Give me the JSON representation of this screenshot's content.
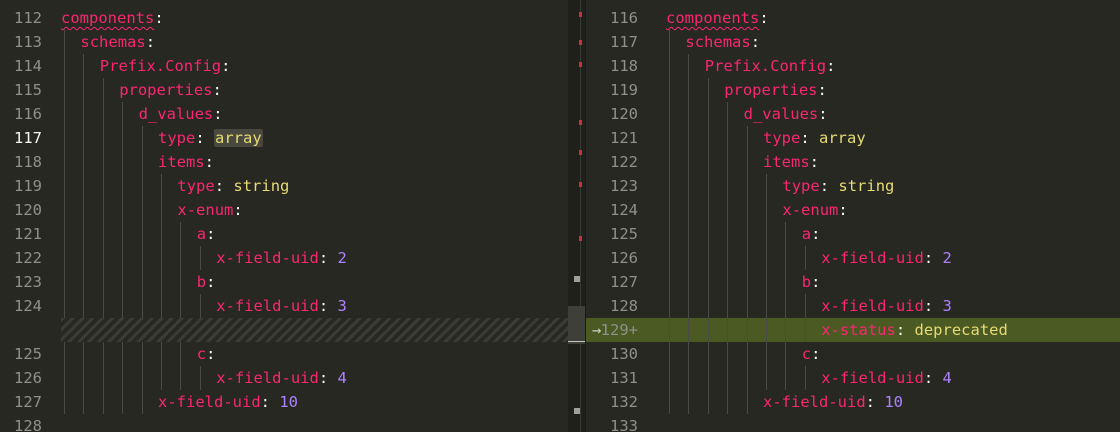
{
  "left": {
    "rows": [
      {
        "ln": "112",
        "active": false,
        "indent": 0,
        "tokens": [
          {
            "t": "components",
            "c": "k",
            "sq": true
          },
          {
            "t": ":",
            "c": "p"
          }
        ]
      },
      {
        "ln": "113",
        "active": false,
        "indent": 1,
        "tokens": [
          {
            "t": "schemas",
            "c": "k"
          },
          {
            "t": ":",
            "c": "p"
          }
        ]
      },
      {
        "ln": "114",
        "active": false,
        "indent": 2,
        "tokens": [
          {
            "t": "Prefix.Config",
            "c": "k"
          },
          {
            "t": ":",
            "c": "p"
          }
        ]
      },
      {
        "ln": "115",
        "active": false,
        "indent": 3,
        "tokens": [
          {
            "t": "properties",
            "c": "k"
          },
          {
            "t": ":",
            "c": "p"
          }
        ]
      },
      {
        "ln": "116",
        "active": false,
        "indent": 4,
        "tokens": [
          {
            "t": "d_values",
            "c": "k"
          },
          {
            "t": ":",
            "c": "p"
          }
        ]
      },
      {
        "ln": "117",
        "active": true,
        "indent": 5,
        "tokens": [
          {
            "t": "type",
            "c": "k"
          },
          {
            "t": ": ",
            "c": "p"
          },
          {
            "t": "array",
            "c": "s",
            "hl": true
          }
        ]
      },
      {
        "ln": "118",
        "active": false,
        "indent": 5,
        "tokens": [
          {
            "t": "items",
            "c": "k"
          },
          {
            "t": ":",
            "c": "p"
          }
        ]
      },
      {
        "ln": "119",
        "active": false,
        "indent": 6,
        "tokens": [
          {
            "t": "type",
            "c": "k"
          },
          {
            "t": ": ",
            "c": "p"
          },
          {
            "t": "string",
            "c": "s"
          }
        ]
      },
      {
        "ln": "120",
        "active": false,
        "indent": 6,
        "tokens": [
          {
            "t": "x-enum",
            "c": "k"
          },
          {
            "t": ":",
            "c": "p"
          }
        ]
      },
      {
        "ln": "121",
        "active": false,
        "indent": 7,
        "tokens": [
          {
            "t": "a",
            "c": "k"
          },
          {
            "t": ":",
            "c": "p"
          }
        ]
      },
      {
        "ln": "122",
        "active": false,
        "indent": 8,
        "tokens": [
          {
            "t": "x-field-uid",
            "c": "k"
          },
          {
            "t": ": ",
            "c": "p"
          },
          {
            "t": "2",
            "c": "n"
          }
        ]
      },
      {
        "ln": "123",
        "active": false,
        "indent": 7,
        "tokens": [
          {
            "t": "b",
            "c": "k"
          },
          {
            "t": ":",
            "c": "p"
          }
        ]
      },
      {
        "ln": "124",
        "active": false,
        "indent": 8,
        "tokens": [
          {
            "t": "x-field-uid",
            "c": "k"
          },
          {
            "t": ": ",
            "c": "p"
          },
          {
            "t": "3",
            "c": "n"
          }
        ]
      },
      {
        "ln": "",
        "active": false,
        "indent": 0,
        "placeholder": true,
        "tokens": []
      },
      {
        "ln": "125",
        "active": false,
        "indent": 7,
        "tokens": [
          {
            "t": "c",
            "c": "k"
          },
          {
            "t": ":",
            "c": "p"
          }
        ]
      },
      {
        "ln": "126",
        "active": false,
        "indent": 8,
        "tokens": [
          {
            "t": "x-field-uid",
            "c": "k"
          },
          {
            "t": ": ",
            "c": "p"
          },
          {
            "t": "4",
            "c": "n"
          }
        ]
      },
      {
        "ln": "127",
        "active": false,
        "indent": 5,
        "tokens": [
          {
            "t": "x-field-uid",
            "c": "k"
          },
          {
            "t": ": ",
            "c": "p"
          },
          {
            "t": "10",
            "c": "n"
          }
        ]
      },
      {
        "ln": "128",
        "active": false,
        "indent": 0,
        "tokens": []
      }
    ]
  },
  "right": {
    "rows": [
      {
        "ln": "116",
        "active": false,
        "indent": 0,
        "tokens": [
          {
            "t": "components",
            "c": "k",
            "sq": true
          },
          {
            "t": ":",
            "c": "p"
          }
        ]
      },
      {
        "ln": "117",
        "active": false,
        "indent": 1,
        "tokens": [
          {
            "t": "schemas",
            "c": "k"
          },
          {
            "t": ":",
            "c": "p"
          }
        ]
      },
      {
        "ln": "118",
        "active": false,
        "indent": 2,
        "tokens": [
          {
            "t": "Prefix.Config",
            "c": "k"
          },
          {
            "t": ":",
            "c": "p"
          }
        ]
      },
      {
        "ln": "119",
        "active": false,
        "indent": 3,
        "tokens": [
          {
            "t": "properties",
            "c": "k"
          },
          {
            "t": ":",
            "c": "p"
          }
        ]
      },
      {
        "ln": "120",
        "active": false,
        "indent": 4,
        "tokens": [
          {
            "t": "d_values",
            "c": "k"
          },
          {
            "t": ":",
            "c": "p"
          }
        ]
      },
      {
        "ln": "121",
        "active": false,
        "indent": 5,
        "tokens": [
          {
            "t": "type",
            "c": "k"
          },
          {
            "t": ": ",
            "c": "p"
          },
          {
            "t": "array",
            "c": "s"
          }
        ]
      },
      {
        "ln": "122",
        "active": false,
        "indent": 5,
        "tokens": [
          {
            "t": "items",
            "c": "k"
          },
          {
            "t": ":",
            "c": "p"
          }
        ]
      },
      {
        "ln": "123",
        "active": false,
        "indent": 6,
        "tokens": [
          {
            "t": "type",
            "c": "k"
          },
          {
            "t": ": ",
            "c": "p"
          },
          {
            "t": "string",
            "c": "s"
          }
        ]
      },
      {
        "ln": "124",
        "active": false,
        "indent": 6,
        "tokens": [
          {
            "t": "x-enum",
            "c": "k"
          },
          {
            "t": ":",
            "c": "p"
          }
        ]
      },
      {
        "ln": "125",
        "active": false,
        "indent": 7,
        "tokens": [
          {
            "t": "a",
            "c": "k"
          },
          {
            "t": ":",
            "c": "p"
          }
        ]
      },
      {
        "ln": "126",
        "active": false,
        "indent": 8,
        "tokens": [
          {
            "t": "x-field-uid",
            "c": "k"
          },
          {
            "t": ": ",
            "c": "p"
          },
          {
            "t": "2",
            "c": "n"
          }
        ]
      },
      {
        "ln": "127",
        "active": false,
        "indent": 7,
        "tokens": [
          {
            "t": "b",
            "c": "k"
          },
          {
            "t": ":",
            "c": "p"
          }
        ]
      },
      {
        "ln": "128",
        "active": false,
        "indent": 8,
        "tokens": [
          {
            "t": "x-field-uid",
            "c": "k"
          },
          {
            "t": ": ",
            "c": "p"
          },
          {
            "t": "3",
            "c": "n"
          }
        ]
      },
      {
        "ln": "129+",
        "active": false,
        "indent": 8,
        "added": true,
        "tokens": [
          {
            "t": "x-status",
            "c": "k"
          },
          {
            "t": ": ",
            "c": "p"
          },
          {
            "t": "deprecated",
            "c": "s"
          }
        ]
      },
      {
        "ln": "130",
        "active": false,
        "indent": 7,
        "tokens": [
          {
            "t": "c",
            "c": "k"
          },
          {
            "t": ":",
            "c": "p"
          }
        ]
      },
      {
        "ln": "131",
        "active": false,
        "indent": 8,
        "tokens": [
          {
            "t": "x-field-uid",
            "c": "k"
          },
          {
            "t": ": ",
            "c": "p"
          },
          {
            "t": "4",
            "c": "n"
          }
        ]
      },
      {
        "ln": "132",
        "active": false,
        "indent": 5,
        "tokens": [
          {
            "t": "x-field-uid",
            "c": "k"
          },
          {
            "t": ": ",
            "c": "p"
          },
          {
            "t": "10",
            "c": "n"
          }
        ]
      },
      {
        "ln": "133",
        "active": false,
        "indent": 0,
        "tokens": []
      }
    ]
  },
  "icons": {
    "added_line_marker": "arrow-right-icon"
  },
  "colors": {
    "background": "#272822",
    "key": "#f92672",
    "string": "#e6db74",
    "number": "#ae81ff",
    "added_line_bg": "#4b5a22"
  }
}
